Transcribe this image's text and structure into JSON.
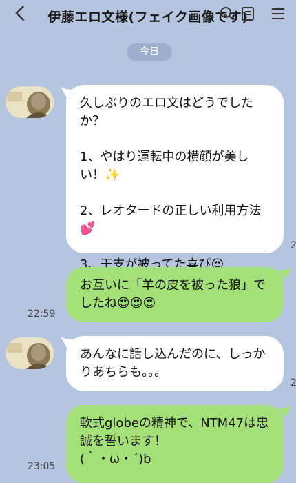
{
  "header": {
    "title": "伊藤エロ文様(フェイク画像です)",
    "back_icon": "chevron-left-icon",
    "icons": [
      "search-icon",
      "notes-icon",
      "menu-icon"
    ]
  },
  "date_divider": "今日",
  "messages": [
    {
      "side": "left",
      "text": "久しぶりのエロ文はどうでしたか？\n\n1、やはり運転中の横顔が美しい！✨\n\n2、レオタードの正しい利用方法💕\n\n3、干支が被ってた喜び😍",
      "time": "2"
    },
    {
      "side": "right",
      "text": "お互いに「羊の皮を被った狼」でしたね😍😍😍",
      "time": "22:59"
    },
    {
      "side": "left",
      "text": "あんなに話し込んだのに、しっかりあちらも。。。",
      "time": "2"
    },
    {
      "side": "right",
      "text": "軟式globeの精神で、NTM47は忠誠を誓います！\n(｀・ω・´)b",
      "time": "23:05"
    }
  ],
  "colors": {
    "background": "#b5c5e0",
    "incoming": "#ffffff",
    "outgoing": "#a3e077",
    "date_pill": "#9eaecd"
  }
}
